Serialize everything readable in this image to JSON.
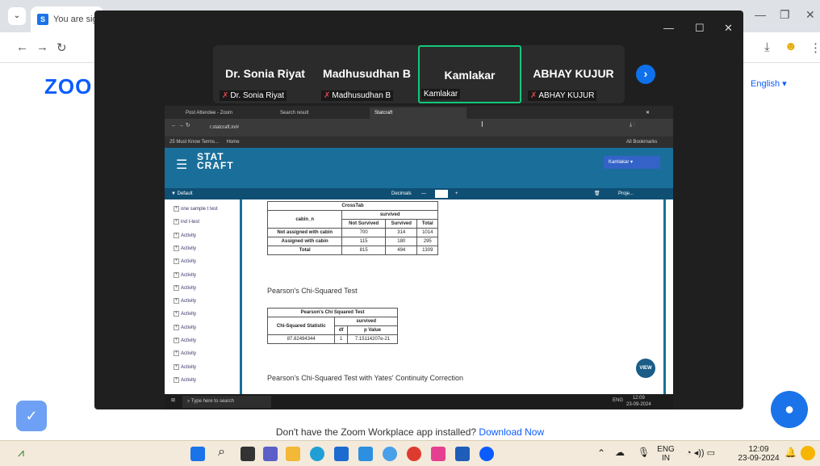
{
  "browser": {
    "tab_title": "You are sign",
    "english_label": "English ▾"
  },
  "zoom": {
    "logo": "ZOO",
    "participants": [
      {
        "name": "Dr. Sonia Riyat",
        "label": "Dr. Sonia Riyat",
        "muted": true
      },
      {
        "name": "Madhusudhan B",
        "label": "Madhusudhan B",
        "muted": true
      },
      {
        "name": "Kamlakar",
        "label": "Kamlakar",
        "muted": false
      },
      {
        "name": "ABHAY KUJUR",
        "label": "ABHAY KUJUR",
        "muted": true
      }
    ],
    "install_text": "Don't have the Zoom Workplace app installed?",
    "install_link": "Download Now"
  },
  "shared_screen": {
    "tabs": [
      "Post Attendee - Zoom",
      "Search result",
      "Statcraft"
    ],
    "url": "r.statcraft.in/#",
    "bookmarks": [
      "25 Must Know Terms...",
      "Home"
    ],
    "all_bookmarks": "All Bookmarks",
    "logo_line1": "STAT",
    "logo_line2": "CRAFT",
    "user": "Kamlakar ▾",
    "toolbar": {
      "default": "Default",
      "decimals": "Decimals",
      "project": "Proje..."
    },
    "sidebar_items": [
      "one sample t test",
      "ind t-test",
      "Activity",
      "Activity",
      "Activity",
      "Activity",
      "Activity",
      "Activity",
      "Activity",
      "Activity",
      "Activity",
      "Activity",
      "Activity",
      "Activity"
    ],
    "crosstab": {
      "title": "CrossTab",
      "row_header": "cabin_n",
      "group_header": "survived",
      "columns": [
        "Not Survived",
        "Survived",
        "Total"
      ],
      "rows": [
        [
          "Not assigned with cabin",
          "700",
          "314",
          "1014"
        ],
        [
          "Assigned with cabin",
          "115",
          "180",
          "295"
        ],
        [
          "Total",
          "815",
          "494",
          "1309"
        ]
      ]
    },
    "chi_title": "Pearson's Chi-Squared Test",
    "chi_table": {
      "title": "Pearson's Chi Squared Test",
      "row_header": "Chi-Squared Statistic",
      "group_header": "survived",
      "columns": [
        "df",
        "p Value"
      ],
      "row": [
        "87.82494344",
        "1",
        "7.15114207e-21"
      ]
    },
    "yates_title": "Pearson's Chi-Squared Test with Yates' Continuity Correction",
    "view_button": "VIEW",
    "taskbar": {
      "search": "Type here to search",
      "time": "12:09",
      "date": "23-09-2024",
      "lang": "ENG"
    }
  },
  "taskbar": {
    "lang_line1": "ENG",
    "lang_line2": "IN",
    "time": "12:09",
    "date": "23-09-2024"
  }
}
